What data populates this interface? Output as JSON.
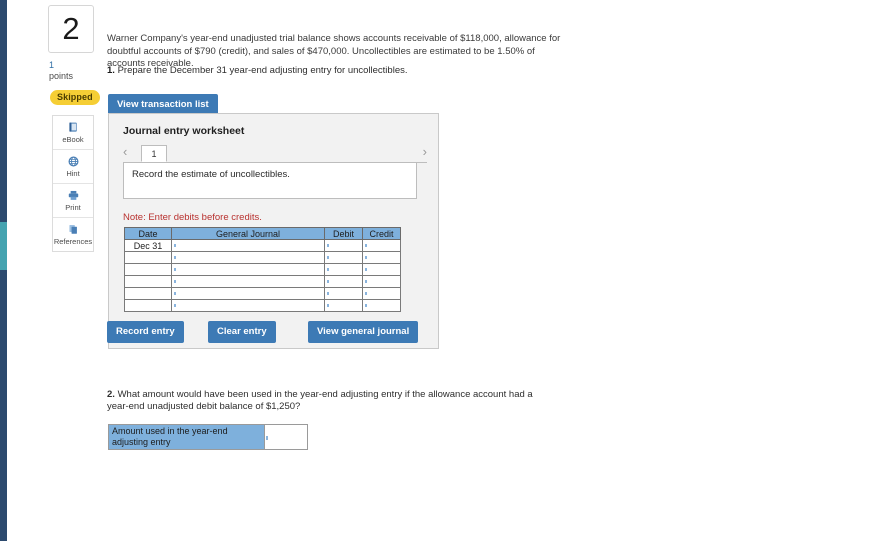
{
  "question": {
    "number": "2",
    "points_value": "1",
    "points_label": "points",
    "status_badge": "Skipped"
  },
  "tools": [
    {
      "label": "eBook",
      "icon": "book-icon"
    },
    {
      "label": "Hint",
      "icon": "globe-icon"
    },
    {
      "label": "Print",
      "icon": "printer-icon"
    },
    {
      "label": "References",
      "icon": "documents-icon"
    }
  ],
  "stem": "Warner Company's year-end unadjusted trial balance shows accounts receivable of $118,000, allowance for doubtful accounts of $790 (credit), and sales of $470,000. Uncollectibles are estimated to be 1.50% of accounts receivable.",
  "requirement1": {
    "number": "1.",
    "text": "Prepare the December 31 year-end adjusting entry for uncollectibles."
  },
  "buttons": {
    "view_transaction_list": "View transaction list",
    "record_entry": "Record entry",
    "clear_entry": "Clear entry",
    "view_general_journal": "View general journal"
  },
  "worksheet": {
    "title": "Journal entry worksheet",
    "tab_prev_icon": "chevron-left-icon",
    "tab_next_icon": "chevron-right-icon",
    "tabs": [
      {
        "label": "1",
        "active": true
      }
    ],
    "instruction": "Record the estimate of uncollectibles.",
    "note": "Note: Enter debits before credits.",
    "table": {
      "headers": [
        "Date",
        "General Journal",
        "Debit",
        "Credit"
      ],
      "rows": [
        {
          "date": "Dec 31",
          "general_journal": "",
          "debit": "",
          "credit": ""
        },
        {
          "date": "",
          "general_journal": "",
          "debit": "",
          "credit": ""
        },
        {
          "date": "",
          "general_journal": "",
          "debit": "",
          "credit": ""
        },
        {
          "date": "",
          "general_journal": "",
          "debit": "",
          "credit": ""
        },
        {
          "date": "",
          "general_journal": "",
          "debit": "",
          "credit": ""
        },
        {
          "date": "",
          "general_journal": "",
          "debit": "",
          "credit": ""
        }
      ]
    }
  },
  "requirement2": {
    "number": "2.",
    "text": "What amount would have been used in the year-end adjusting entry if the allowance account had a year-end unadjusted debit balance of $1,250?",
    "answer_label": "Amount used in the year-end adjusting entry",
    "answer_value": ""
  },
  "colors": {
    "button_blue": "#3d7ab5",
    "table_header_blue": "#7eb0dc",
    "badge_yellow": "#f5ce35",
    "note_red": "#b8312f",
    "rail_navy": "#2c4a6e",
    "rail_active_teal": "#45a3b0"
  }
}
